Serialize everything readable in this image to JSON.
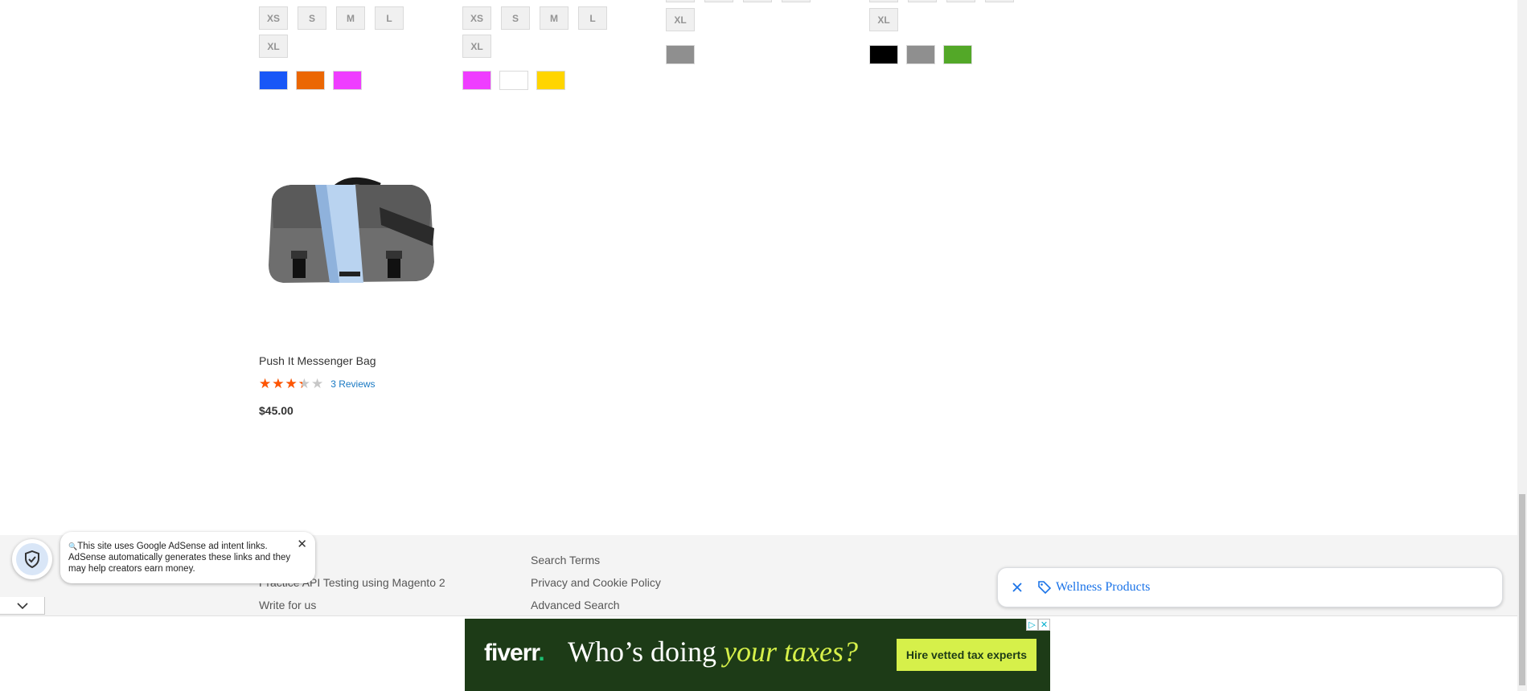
{
  "products_top": [
    {
      "sizes_row1": [
        "XS",
        "S",
        "M",
        "L"
      ],
      "sizes_row2": [
        "XL"
      ],
      "colors": [
        "#1857f7",
        "#eb6703",
        "#ef3dff"
      ]
    },
    {
      "sizes_row1": [
        "XS",
        "S",
        "M",
        "L"
      ],
      "sizes_row2": [
        "XL"
      ],
      "colors": [
        "#ef3dff",
        "#ffffff",
        "#ffd500"
      ]
    },
    {
      "sizes_row2": [
        "XL"
      ],
      "colors": [
        "#8f8f8f"
      ]
    },
    {
      "sizes_row2": [
        "XL"
      ],
      "colors": [
        "#000000",
        "#8f8f8f",
        "#53a828"
      ]
    }
  ],
  "product": {
    "name": "Push It Messenger Bag",
    "rating_percent": 67,
    "stars": "★★★★★",
    "reviews_label": "3 Reviews",
    "price": "$45.00"
  },
  "footer": {
    "col1": [
      "Practice API Testing using Magento 2",
      "Write for us"
    ],
    "col2": [
      "Search Terms",
      "Privacy and Cookie Policy",
      "Advanced Search"
    ]
  },
  "adsense_notice": {
    "text": "This site uses Google AdSense ad intent links. AdSense automatically generates these links and they may help creators earn money."
  },
  "search_chip": {
    "label": "Wellness Products"
  },
  "ad": {
    "logo": "fiverr",
    "logo_dot": ".",
    "headline_plain": "Who’s doing ",
    "headline_emphasis": "your taxes?",
    "cta": "Hire vetted tax experts"
  },
  "colors": {
    "accent_link": "#1979c3",
    "star": "#ff5501",
    "ad_bg": "#1d3b17",
    "ad_accent": "#d6f04a"
  }
}
